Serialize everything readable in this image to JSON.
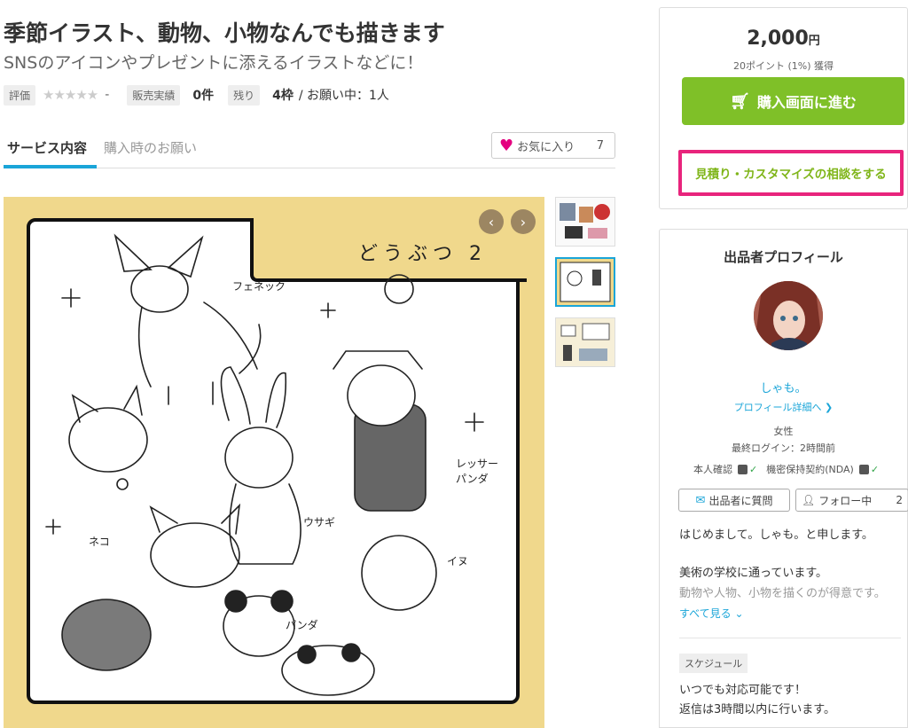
{
  "service": {
    "title": "季節イラスト、動物、小物なんでも描きます",
    "subtitle": "SNSのアイコンやプレゼントに添えるイラストなどに！"
  },
  "meta": {
    "rating_label": "評価",
    "rating_stars": "★★★★★",
    "rating_value": "-",
    "sales_label": "販売実績",
    "sales_value": "0件",
    "remaining_label": "残り",
    "remaining_value": "4枠",
    "in_progress": "/ お願い中：1人"
  },
  "tabs": {
    "service_content": "サービス内容",
    "purchase_request": "購入時のお願い"
  },
  "favorite": {
    "label": "お気に入り",
    "count": "7"
  },
  "image": {
    "caption": "どうぶつ 2",
    "labels": {
      "fennec": "フェネック",
      "red_panda": "レッサーパンダ",
      "rabbit": "ウサギ",
      "cat": "ネコ",
      "dog": "イヌ",
      "panda": "パンダ"
    }
  },
  "purchase": {
    "price": "2,000",
    "currency": "円",
    "points": "20ポイント (1%) 獲得",
    "buy_label": "購入画面に進む",
    "consult_label": "見積り・カスタマイズの相談をする"
  },
  "profile": {
    "title": "出品者プロフィール",
    "name": "しゃも。",
    "detail_link": "プロフィール詳細へ",
    "gender": "女性",
    "last_login": "最終ログイン：2時間前",
    "identity": "本人確認",
    "nda": "機密保持契約(NDA)",
    "ask_label": "出品者に質問",
    "follow_label": "フォロー中",
    "follow_count": "2",
    "bio_line1": "はじめまして。しゃも。と申します。",
    "bio_line2": "美術の学校に通っています。",
    "bio_line3": "動物や人物、小物を描くのが得意です。",
    "see_all": "すべて見る",
    "schedule_tag": "スケジュール",
    "schedule_line1": "いつでも対応可能です！",
    "schedule_line2": "返信は3時間以内に行います。"
  },
  "colors": {
    "accent_blue": "#1aa5d8",
    "buy_green": "#7fc028",
    "highlight_pink": "#e8247c",
    "image_bg": "#f0d88c"
  }
}
